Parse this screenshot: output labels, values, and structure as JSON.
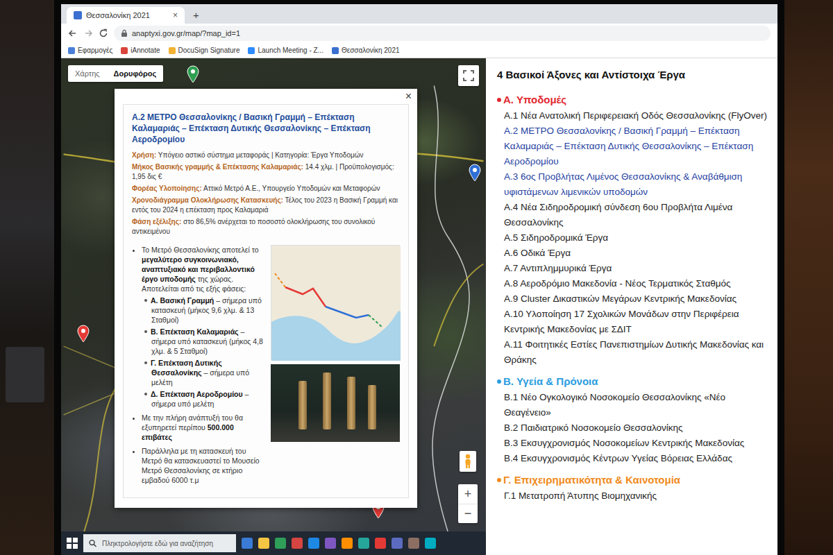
{
  "browser": {
    "tabs": [
      {
        "label": "Θεσσαλονίκη 2021",
        "selected": true,
        "close": "×"
      }
    ],
    "new_tab": "+",
    "address": "anaptyxi.gov.gr/map/?map_id=1",
    "bookmarks": [
      {
        "label": "Εφαρμογές",
        "color": "#4a7fd8"
      },
      {
        "label": "iAnnotate",
        "color": "#d9453b"
      },
      {
        "label": "DocuSign Signature",
        "color": "#f2b233"
      },
      {
        "label": "Launch Meeting - Z...",
        "color": "#2d8cff"
      },
      {
        "label": "Θεσσαλονίκη 2021",
        "color": "#3b6fd0"
      }
    ]
  },
  "map": {
    "type_buttons": [
      {
        "label": "Χάρτης",
        "selected": false
      },
      {
        "label": "Δορυφόρος",
        "selected": true
      }
    ],
    "zoom": [
      "+",
      "−"
    ],
    "pins": [
      {
        "color": "#2e9e4f"
      },
      {
        "color": "#2f6fd6"
      },
      {
        "color": "#e53935"
      },
      {
        "color": "#e53935"
      },
      {
        "color": "#e53935"
      },
      {
        "color": "#e53935"
      },
      {
        "color": "#e53935"
      }
    ]
  },
  "popup": {
    "close": "×",
    "title": "Α.2 ΜΕΤΡΟ Θεσσαλονίκης / Βασική Γραμμή – Επέκταση Καλαμαριάς – Επέκταση Δυτικής Θεσσαλονίκης – Επέκταση Αεροδρομίου",
    "meta": [
      {
        "label": "Χρήση:",
        "value": "Υπόγειο αστικό σύστημα μεταφοράς | Κατηγορία: Έργα Υποδομών"
      },
      {
        "label": "Μήκος Βασικής γραμμής & Επέκτασης Καλαμαριάς:",
        "value": "14.4 χλμ. | Προϋπολογισμός: 1,95 δις €"
      },
      {
        "label": "Φορέας Υλοποίησης:",
        "value": "Αττικό Μετρό Α.Ε., Υπουργείο Υποδομών και Μεταφορών"
      },
      {
        "label": "Χρονοδιάγραμμα Ολοκλήρωσης Κατασκευής:",
        "value": "Τέλος του 2023 η Βασική Γραμμή και εντός του 2024 η επέκταση προς Καλαμαριά"
      },
      {
        "label": "Φάση εξέλιξης:",
        "value": "στο 86,5% ανέρχεται το ποσοστό ολοκλήρωσης του συνολικού αντικειμένου"
      }
    ],
    "bullets": [
      {
        "parts": [
          {
            "text": "Το Μετρό Θεσσαλονίκης αποτελεί το ",
            "bold": false
          },
          {
            "text": "μεγαλύτερο συγκοινωνιακό, αναπτυξιακό και περιβαλλοντικό έργο υποδομής",
            "bold": true
          },
          {
            "text": " της χώρας. Αποτελείται από τις εξής φάσεις:",
            "bold": false
          }
        ],
        "subitems": [
          {
            "parts": [
              {
                "text": "Α. Βασική Γραμμή",
                "bold": true
              },
              {
                "text": " – σήμερα υπό κατασκευή (μήκος 9,6 χλμ. & 13 Σταθμοί)",
                "bold": false
              }
            ]
          },
          {
            "parts": [
              {
                "text": "Β. Επέκταση Καλαμαριάς",
                "bold": true
              },
              {
                "text": " – σήμερα υπό κατασκευή (μήκος 4,8 χλμ. & 5 Σταθμοί)",
                "bold": false
              }
            ]
          },
          {
            "parts": [
              {
                "text": "Γ. Επέκταση Δυτικής Θεσσαλονίκης",
                "bold": true
              },
              {
                "text": " – σήμερα υπό μελέτη",
                "bold": false
              }
            ]
          },
          {
            "parts": [
              {
                "text": "Δ. Επέκταση Αεροδρομίου",
                "bold": true
              },
              {
                "text": " – σήμερα υπό μελέτη",
                "bold": false
              }
            ]
          }
        ]
      },
      {
        "parts": [
          {
            "text": "Με την πλήρη ανάπτυξή του θα εξυπηρετεί περίπου ",
            "bold": false
          },
          {
            "text": "500.000 επιβάτες",
            "bold": true
          }
        ],
        "subitems": []
      },
      {
        "parts": [
          {
            "text": "Παράλληλα με τη κατασκευή του Μετρό θα κατασκευαστεί το Μουσείο Μετρό Θεσσαλονίκης σε κτήριο εμβαδού 6000 τ.μ",
            "bold": false
          }
        ],
        "subitems": []
      }
    ]
  },
  "panel": {
    "title": "4 Βασικοί Άξονες και Αντίστοιχα Έργα",
    "sections": [
      {
        "title": "Α. Υποδομές",
        "color": "#e3262f",
        "items": [
          {
            "text": "Α.1 Νέα Ανατολική Περιφερειακή Οδός Θεσσαλονίκης (FlyOver)",
            "highlighted": false
          },
          {
            "text": "Α.2 ΜΕΤΡΟ Θεσσαλονίκης / Βασική Γραμμή – Επέκταση Καλαμαριάς – Επέκταση Δυτικής Θεσσαλονίκης – Επέκταση Αεροδρομίου",
            "highlighted": true
          },
          {
            "text": "Α.3 6ος Προβλήτας Λιμένος Θεσσαλονίκης & Αναβάθμιση υφιστάμενων λιμενικών υποδομών",
            "highlighted": true
          },
          {
            "text": "Α.4 Νέα Σιδηροδρομική σύνδεση 6ου Προβλήτα Λιμένα Θεσσαλονίκης",
            "highlighted": false
          },
          {
            "text": "Α.5 Σιδηροδρομικά Έργα",
            "highlighted": false
          },
          {
            "text": "Α.6 Οδικά Έργα",
            "highlighted": false
          },
          {
            "text": "Α.7 Αντιπλημμυρικά Έργα",
            "highlighted": false
          },
          {
            "text": "Α.8 Αεροδρόμιο Μακεδονία - Νέος Τερματικός Σταθμός",
            "highlighted": false
          },
          {
            "text": "Α.9 Cluster Δικαστικών Μεγάρων Κεντρικής Μακεδονίας",
            "highlighted": false
          },
          {
            "text": "Α.10 Υλοποίηση 17 Σχολικών Μονάδων στην Περιφέρεια Κεντρικής Μακεδονίας με ΣΔΙΤ",
            "highlighted": false
          },
          {
            "text": "Α.11 Φοιτητικές Εστίες Πανεπιστημίων Δυτικής Μακεδονίας και Θράκης",
            "highlighted": false
          }
        ]
      },
      {
        "title": "Β. Υγεία & Πρόνοια",
        "color": "#2a9de0",
        "items": [
          {
            "text": "Β.1 Νέο Ογκολογικό Νοσοκομείο Θεσσαλονίκης «Νέο Θεαγένειο»",
            "highlighted": false
          },
          {
            "text": "Β.2 Παιδιατρικό Νοσοκομείο Θεσσαλονίκης",
            "highlighted": false
          },
          {
            "text": "Β.3 Εκσυγχρονισμός Νοσοκομείων Κεντρικής Μακεδονίας",
            "highlighted": false
          },
          {
            "text": "Β.4 Εκσυγχρονισμός Κέντρων Υγείας Βόρειας Ελλάδας",
            "highlighted": false
          }
        ]
      },
      {
        "title": "Γ. Επιχειρηματικότητα & Καινοτομία",
        "color": "#f08a1c",
        "items": [
          {
            "text": "Γ.1 Μετατροπή Άτυπης Βιομηχανικής",
            "highlighted": false
          }
        ]
      }
    ]
  },
  "taskbar": {
    "search": {
      "placeholder": "Πληκτρολογήστε εδώ για αναζήτηση"
    },
    "apps": [
      {
        "color": "#3a7bd5"
      },
      {
        "color": "#f4c542"
      },
      {
        "color": "#2f9e58"
      },
      {
        "color": "#d64541"
      },
      {
        "color": "#1e88e5"
      },
      {
        "color": "#7e57c2"
      },
      {
        "color": "#ff8f00"
      },
      {
        "color": "#26a69a"
      },
      {
        "color": "#e53935"
      },
      {
        "color": "#5c6bc0"
      },
      {
        "color": "#8d6e63"
      },
      {
        "color": "#00acc1"
      }
    ]
  }
}
